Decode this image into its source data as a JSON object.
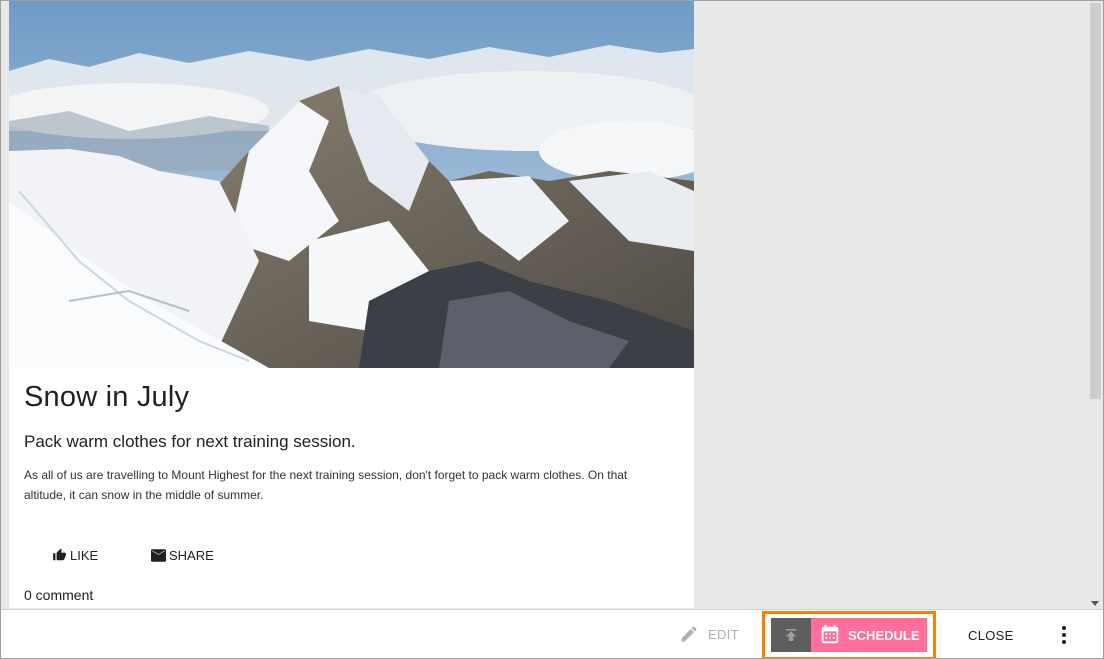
{
  "post": {
    "title": "Snow in July",
    "subtitle": "Pack warm clothes for next training session.",
    "body": "As all of us are travelling to Mount Highest for the next training session, don't forget to pack warm clothes. On that altitude, it can snow in the middle of summer.",
    "like_label": "LIKE",
    "share_label": "SHARE",
    "comment_count": "0 comment",
    "hero_image": "snowy-mountain-peak-photo"
  },
  "toolbar": {
    "edit_label": "EDIT",
    "schedule_label": "SCHEDULE",
    "close_label": "CLOSE"
  },
  "colors": {
    "schedule_bg": "#ff6f9a",
    "publish_bg": "#5e5e5e",
    "highlight_border": "#ff8000",
    "edit_disabled": "#b0b0b0"
  },
  "icons": {
    "edit": "pencil-icon",
    "publish": "publish-icon",
    "schedule": "calendar-icon",
    "like": "thumbs-up-icon",
    "share": "envelope-icon",
    "more": "more-vert-icon"
  }
}
